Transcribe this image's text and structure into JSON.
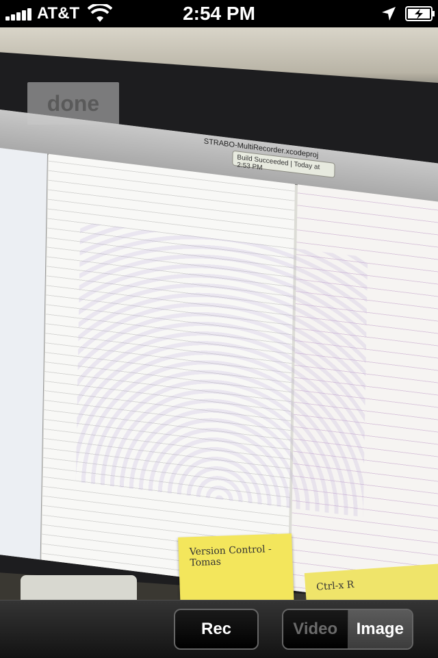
{
  "status_bar": {
    "carrier": "AT&T",
    "time": "2:54 PM",
    "icons": [
      "signal-bars-icon",
      "wifi-icon",
      "location-arrow-icon",
      "battery-charging-icon"
    ]
  },
  "viewfinder": {
    "done_label": "done",
    "screen": {
      "xcode_title": "STRABO-MultiRecorder.xcodeproj",
      "build_status": "Build Succeeded | Today at 2:53 PM"
    },
    "sticky_note": "Version Control - Tomas",
    "sticky_note_2": "Ctrl-x R"
  },
  "controls": {
    "rec_label": "Rec",
    "mode_options": [
      "Video",
      "Image"
    ],
    "selected_mode": "Image"
  },
  "colors": {
    "bar_bg": "#1a1a1a",
    "selected_segment": "#4a4a4a",
    "unselected_text": "#6b6b6b"
  }
}
